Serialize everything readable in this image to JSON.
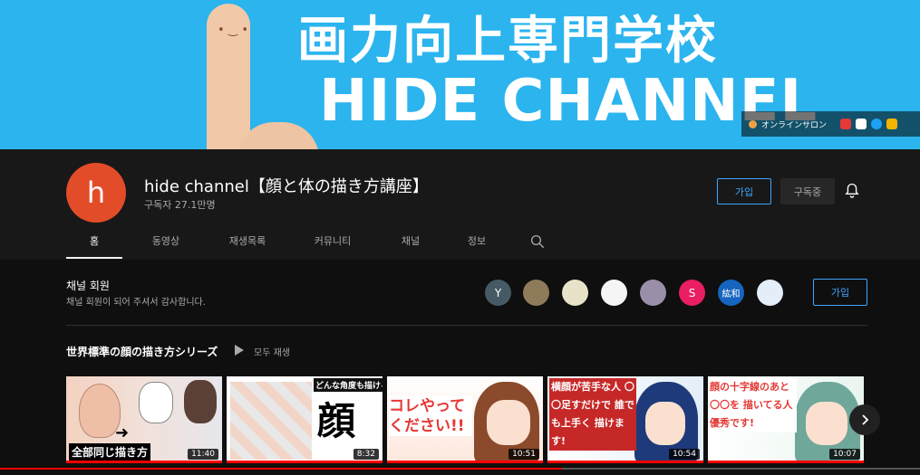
{
  "banner": {
    "title": "画力向上専門学校",
    "subtitle": "HIDE CHANNEL",
    "link_label": "オンラインサロン"
  },
  "channel": {
    "avatar_letter": "h",
    "name": "hide channel【顔と体の描き方講座】",
    "subscribers": "구독자 27.1만명",
    "join_label": "가입",
    "subscribed_label": "구독중"
  },
  "tabs": [
    "홈",
    "동영상",
    "재생목록",
    "커뮤니티",
    "채널",
    "정보"
  ],
  "members": {
    "title": "채널 회원",
    "subtitle": "채널 회원이 되어 주셔서 감사합니다.",
    "avatars": [
      "Y",
      "",
      "",
      "",
      "",
      "S",
      "紘和",
      ""
    ],
    "join_label": "가입"
  },
  "playlist": {
    "title": "世界標準の顔の描き方シリーズ",
    "play_all": "모두 재생",
    "videos": [
      {
        "caption": "全部同じ描き方",
        "duration": "11:40",
        "progress": 1.0
      },
      {
        "caption": "どんな角度も描ける 顔 描き方",
        "duration": "8:32",
        "progress": 1.0
      },
      {
        "caption": "コレやってください!!",
        "duration": "10:51",
        "progress": 1.0
      },
      {
        "caption": "横顔が苦手な人 〇〇足すだけで 誰でも上手く 描けます!",
        "duration": "10:54",
        "progress": 1.0
      },
      {
        "caption": "顔の十字線のあと 〇〇を 描いてる人 優秀です!",
        "duration": "10:07",
        "progress": 1.0
      }
    ]
  },
  "colors": {
    "banner_bg": "#2bb4ee",
    "avatar_bg": "#e34c29",
    "accent_blue": "#3ea6ff",
    "progress_red": "#ff0000"
  }
}
